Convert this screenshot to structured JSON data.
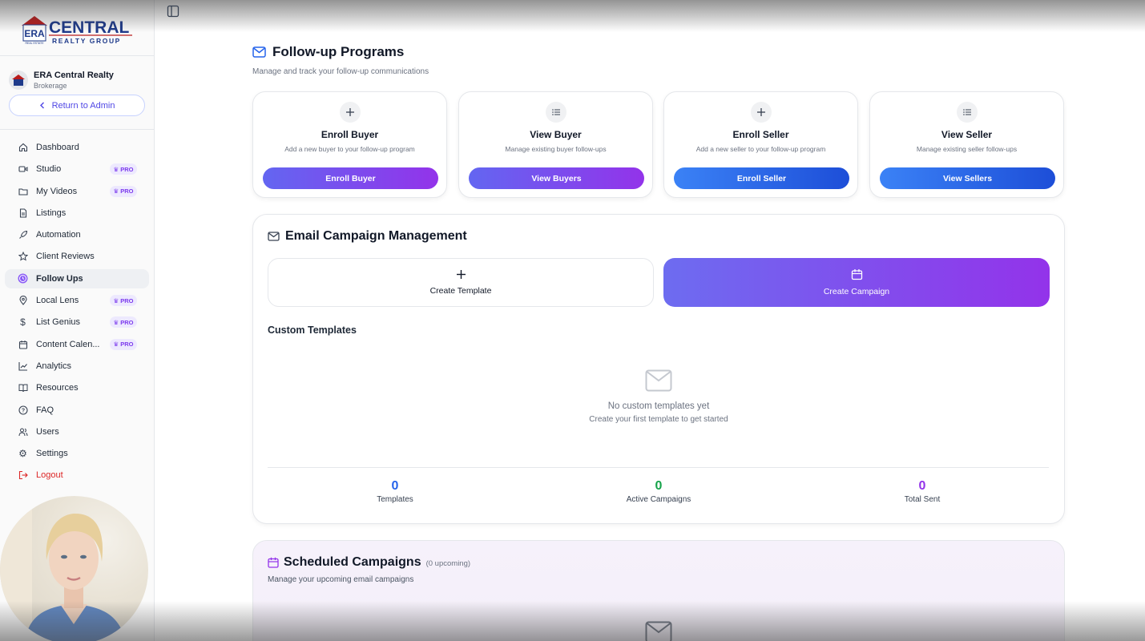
{
  "brand": {
    "logo_mark": "ERA",
    "logo_word": "CENTRAL",
    "logo_tag": "REALTY GROUP",
    "logo_small": "REAL ESTATE"
  },
  "brokerage": {
    "name": "ERA Central Realty",
    "type": "Brokerage",
    "return_label": "Return to Admin"
  },
  "nav": {
    "pro_label": "PRO",
    "items": [
      {
        "label": "Dashboard",
        "icon": "home-icon"
      },
      {
        "label": "Studio",
        "icon": "video-icon",
        "pro": true
      },
      {
        "label": "My Videos",
        "icon": "folder-icon",
        "pro": true
      },
      {
        "label": "Listings",
        "icon": "document-icon"
      },
      {
        "label": "Automation",
        "icon": "rocket-icon"
      },
      {
        "label": "Client Reviews",
        "icon": "star-icon"
      },
      {
        "label": "Follow Ups",
        "icon": "clock-icon",
        "active": true
      },
      {
        "label": "Local Lens",
        "icon": "map-pin-icon",
        "pro": true
      },
      {
        "label": "List Genius",
        "icon": "dollar-icon",
        "pro": true
      },
      {
        "label": "Content Calen...",
        "icon": "calendar-icon",
        "pro": true
      },
      {
        "label": "Analytics",
        "icon": "chart-icon"
      },
      {
        "label": "Resources",
        "icon": "book-icon"
      },
      {
        "label": "FAQ",
        "icon": "help-icon"
      },
      {
        "label": "Users",
        "icon": "users-icon"
      },
      {
        "label": "Settings",
        "icon": "gear-icon"
      },
      {
        "label": "Logout",
        "icon": "logout-icon"
      }
    ]
  },
  "header": {
    "title": "Follow-up Programs",
    "subtitle": "Manage and track your follow-up communications"
  },
  "programs": [
    {
      "title": "Enroll Buyer",
      "desc": "Add a new buyer to your follow-up program",
      "button": "Enroll Buyer",
      "icon": "plus-icon"
    },
    {
      "title": "View Buyer",
      "desc": "Manage existing buyer follow-ups",
      "button": "View Buyers",
      "icon": "list-icon"
    },
    {
      "title": "Enroll Seller",
      "desc": "Add a new seller to your follow-up program",
      "button": "Enroll Seller",
      "icon": "plus-icon"
    },
    {
      "title": "View Seller",
      "desc": "Manage existing seller follow-ups",
      "button": "View Sellers",
      "icon": "list-icon"
    }
  ],
  "email_campaign": {
    "title": "Email Campaign Management",
    "create_template": "Create Template",
    "create_campaign": "Create Campaign",
    "custom_templates": "Custom Templates",
    "empty_title": "No custom templates yet",
    "empty_sub": "Create your first template to get started",
    "stats": [
      {
        "value": "0",
        "label": "Templates",
        "color": "#2563eb"
      },
      {
        "value": "0",
        "label": "Active Campaigns",
        "color": "#16a34a"
      },
      {
        "value": "0",
        "label": "Total Sent",
        "color": "#9333ea"
      }
    ]
  },
  "scheduled": {
    "title": "Scheduled Campaigns",
    "count": "(0 upcoming)",
    "subtitle": "Manage your upcoming email campaigns"
  },
  "colors": {
    "accent_purple": "#9333ea",
    "accent_indigo": "#6366f1",
    "accent_blue": "#2563eb",
    "logout_red": "#dc2626"
  }
}
